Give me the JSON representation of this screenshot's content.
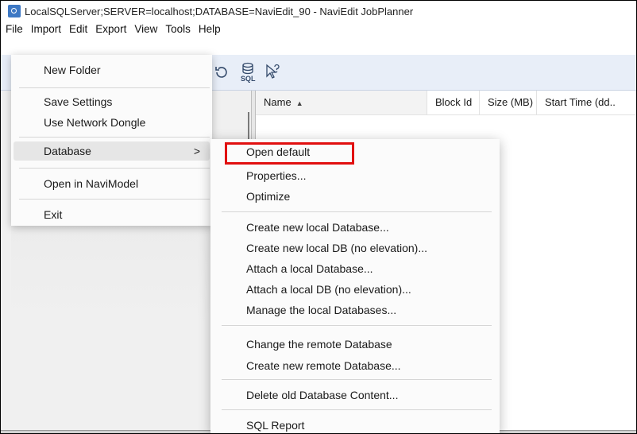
{
  "window": {
    "title": "LocalSQLServer;SERVER=localhost;DATABASE=NaviEdit_90 - NaviEdit JobPlanner"
  },
  "menubar": [
    "File",
    "Import",
    "Edit",
    "Export",
    "View",
    "Tools",
    "Help"
  ],
  "toolbar": {
    "sql_label": "SQL"
  },
  "file_menu": {
    "items": [
      "New Folder",
      "Save Settings",
      "Use Network Dongle",
      "Database",
      "Open in NaviModel",
      "Exit"
    ],
    "submenu_chevron": ">"
  },
  "database_submenu": {
    "items": [
      "Open default",
      "Properties...",
      "Optimize",
      "Create new local Database...",
      "Create new local DB (no elevation)...",
      "Attach a local Database...",
      "Attach a local DB (no elevation)...",
      "Manage the local Databases...",
      "Change the remote Database",
      "Create new remote Database...",
      "Delete old Database Content...",
      "SQL Report"
    ],
    "highlighted_item": "Open default"
  },
  "grid": {
    "columns": [
      "Name",
      "Block Id",
      "Size (MB)",
      "Start Time (dd.."
    ],
    "sort_indicator": "▲"
  },
  "colors": {
    "highlight_border": "#e10f0f",
    "toolbar_bg": "#e8eef8",
    "menu_bg": "#fbfbfb"
  }
}
